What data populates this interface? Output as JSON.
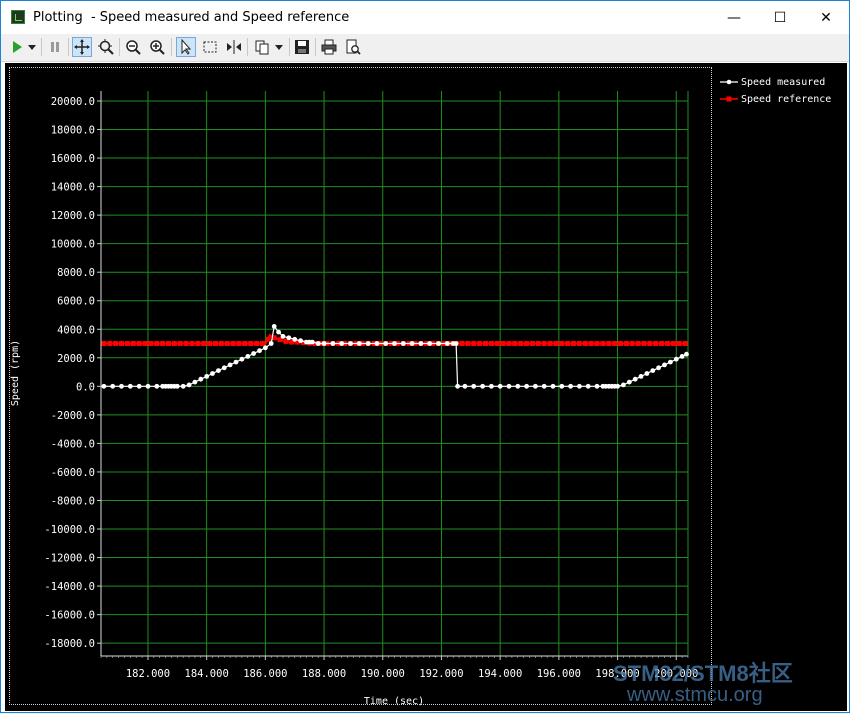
{
  "window": {
    "title": "Plotting  - Speed measured and Speed reference",
    "minimize": "—",
    "maximize": "☐",
    "close": "✕"
  },
  "toolbar": {
    "items": [
      "run",
      "dropdown",
      "pause",
      "pan",
      "zoom-fit",
      "zoom-out",
      "zoom-in",
      "select",
      "select-box",
      "cursor",
      "copy",
      "copy-dropdown",
      "save",
      "print",
      "print-preview"
    ]
  },
  "chart_data": {
    "type": "line",
    "xlabel": "Time (sec)",
    "ylabel": "Speed (rpm)",
    "xlim": [
      180.4,
      200.4
    ],
    "ylim": [
      -18900,
      20700
    ],
    "x_ticks": [
      "182.000",
      "184.000",
      "186.000",
      "188.000",
      "190.000",
      "192.000",
      "194.000",
      "196.000",
      "198.000",
      "200.000"
    ],
    "x_tick_values": [
      182,
      184,
      186,
      188,
      190,
      192,
      194,
      196,
      198,
      200
    ],
    "y_ticks": [
      "20000.0",
      "18000.0",
      "16000.0",
      "14000.0",
      "12000.0",
      "10000.0",
      "8000.0",
      "6000.0",
      "4000.0",
      "2000.0",
      "0.0",
      "-2000.0",
      "-4000.0",
      "-6000.0",
      "-8000.0",
      "-10000.0",
      "-12000.0",
      "-14000.0",
      "-16000.0",
      "-18000.0"
    ],
    "y_tick_values": [
      20000,
      18000,
      16000,
      14000,
      12000,
      10000,
      8000,
      6000,
      4000,
      2000,
      0,
      -2000,
      -4000,
      -6000,
      -8000,
      -10000,
      -12000,
      -14000,
      -16000,
      -18000
    ],
    "grid": true,
    "legend_placement": "top-right",
    "series": [
      {
        "name": "Speed measured",
        "color": "#ffffff",
        "x": [
          180.5,
          180.8,
          181.1,
          181.4,
          181.7,
          182.0,
          182.3,
          182.5,
          182.6,
          182.7,
          182.8,
          182.9,
          183.0,
          183.2,
          183.4,
          183.6,
          183.8,
          184.0,
          184.2,
          184.4,
          184.6,
          184.8,
          185.0,
          185.2,
          185.4,
          185.6,
          185.8,
          186.0,
          186.2,
          186.3,
          186.45,
          186.6,
          186.8,
          187.0,
          187.2,
          187.4,
          187.5,
          187.6,
          187.8,
          188.0,
          188.3,
          188.6,
          188.9,
          189.2,
          189.5,
          189.8,
          190.1,
          190.4,
          190.7,
          191.0,
          191.3,
          191.6,
          191.9,
          192.2,
          192.4,
          192.5,
          192.55,
          192.8,
          193.1,
          193.4,
          193.7,
          194.0,
          194.3,
          194.6,
          194.9,
          195.2,
          195.5,
          195.8,
          196.1,
          196.4,
          196.7,
          197.0,
          197.3,
          197.5,
          197.6,
          197.7,
          197.8,
          197.9,
          198.0,
          198.2,
          198.4,
          198.6,
          198.8,
          199.0,
          199.2,
          199.4,
          199.6,
          199.8,
          200.0,
          200.2,
          200.35
        ],
        "y": [
          0,
          0,
          0,
          0,
          0,
          0,
          0,
          0,
          0,
          0,
          0,
          0,
          0,
          0,
          100,
          300,
          500,
          700,
          900,
          1100,
          1300,
          1500,
          1700,
          1900,
          2100,
          2300,
          2500,
          2700,
          3000,
          4200,
          3800,
          3500,
          3400,
          3300,
          3200,
          3100,
          3100,
          3100,
          3000,
          3000,
          3000,
          3000,
          3000,
          3000,
          3000,
          3000,
          3000,
          3000,
          3000,
          3000,
          3000,
          3000,
          3000,
          3000,
          3000,
          3000,
          0,
          0,
          0,
          0,
          0,
          0,
          0,
          0,
          0,
          0,
          0,
          0,
          0,
          0,
          0,
          0,
          0,
          0,
          0,
          0,
          0,
          0,
          0,
          100,
          300,
          500,
          700,
          900,
          1100,
          1300,
          1500,
          1700,
          1900,
          2100,
          2250
        ]
      },
      {
        "name": "Speed reference",
        "color": "#ff0000",
        "x": [
          180.5,
          181.0,
          181.5,
          182.0,
          182.5,
          183.0,
          183.5,
          184.0,
          184.5,
          185.0,
          185.5,
          186.0,
          186.1,
          186.15,
          186.3,
          186.45,
          186.6,
          186.8,
          187.0,
          187.2,
          187.4,
          187.6,
          187.8,
          188.0,
          188.5,
          189.0,
          189.5,
          190.0,
          190.5,
          191.0,
          191.5,
          192.0,
          192.5,
          193.0,
          193.5,
          194.0,
          194.5,
          195.0,
          195.5,
          196.0,
          196.5,
          197.0,
          197.5,
          198.0,
          198.5,
          199.0,
          199.5,
          200.0,
          200.35
        ],
        "y": [
          3000,
          3000,
          3000,
          3000,
          3000,
          3000,
          3000,
          3000,
          3000,
          3000,
          3000,
          3000,
          3300,
          3600,
          3400,
          3300,
          3200,
          3100,
          3100,
          3100,
          3050,
          3000,
          3000,
          3000,
          3000,
          3000,
          3000,
          3000,
          3000,
          3000,
          3000,
          3000,
          3000,
          3000,
          3000,
          3000,
          3000,
          3000,
          3000,
          3000,
          3000,
          3000,
          3000,
          3000,
          3000,
          3000,
          3000,
          3000,
          3000
        ]
      }
    ]
  },
  "watermark": {
    "line1": "STM32/STM8社区",
    "line2": "www.stmcu.org"
  }
}
